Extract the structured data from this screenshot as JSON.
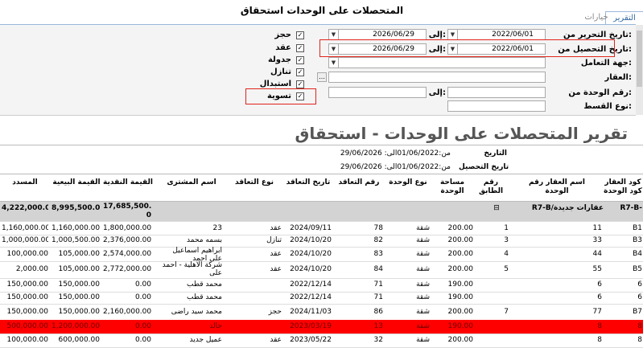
{
  "window": {
    "title": "المتحصلات على الوحدات استحقاق"
  },
  "tabs": [
    {
      "label": "التقرير",
      "active": true
    },
    {
      "label": "خيارات",
      "active": false
    }
  ],
  "filters": {
    "edit_date_label": "تاريخ التحرير من:",
    "edit_from": "2022/06/01",
    "edit_to_label": "إلى:",
    "edit_to": "2026/06/29",
    "collect_date_label": "تاريخ التحصيل من:",
    "collect_from": "2022/06/01",
    "collect_to_label": "إلى:",
    "collect_to": "2026/06/29",
    "party_label": "جهة التعامل:",
    "property_label": "العقار:",
    "unit_no_label": "رقم الوحدة من:",
    "unit_to_label": "إلى:",
    "installment_label": "نوع القسط:"
  },
  "checks": [
    {
      "label": "حجز",
      "checked": true
    },
    {
      "label": "عقد",
      "checked": true
    },
    {
      "label": "جدولة",
      "checked": true
    },
    {
      "label": "تنازل",
      "checked": true
    },
    {
      "label": "استبدال",
      "checked": true
    },
    {
      "label": "تسوية",
      "checked": true
    }
  ],
  "report": {
    "title": "تقرير المتحصلات على الوحدات - استحقاق",
    "date_label": "التاريخ",
    "date_range": "من:01/06/2022الى: 29/06/2026",
    "collect_label": "تاريخ التحصيل",
    "collect_range": "من:01/06/2022الى: 29/06/2026"
  },
  "columns": {
    "code": "كود العقار كود الوحدة",
    "uno": "اسم العقار رقم الوحدة",
    "floor": "رقم الطابق",
    "area": "مساحة الوحدة",
    "utype": "نوع الوحدة",
    "cno": "رقم التعاقد",
    "cdate": "تاريخ التعاقد",
    "ctype": "نوع التعاقد",
    "buyer": "اسم المشترى",
    "cash": "القيمة النقدية",
    "sale": "القيمة البيعية",
    "paid": "المسدد"
  },
  "group": {
    "code": "R7-B-",
    "name": "R7-B/عقارات جديدة",
    "expander": "⊟",
    "cash": "17,685,500.0",
    "cash_cont": "0",
    "sale": "8,995,500.00",
    "paid": "4,222,000.00"
  },
  "rows": [
    {
      "code": "B1",
      "uno": "11",
      "floor": "1",
      "area": "200.00",
      "utype": "شقة",
      "cno": "78",
      "cdate": "2024/09/11",
      "ctype": "عقد",
      "buyer": "23",
      "cash": "1,800,000.00",
      "sale": "1,160,000.00",
      "paid": "1,160,000.00",
      "red": false
    },
    {
      "code": "B3",
      "uno": "33",
      "floor": "3",
      "area": "200.00",
      "utype": "شقة",
      "cno": "82",
      "cdate": "2024/10/20",
      "ctype": "تنازل",
      "buyer": "بسمه محمد",
      "cash": "2,376,000.00",
      "sale": "1,000,500.00",
      "paid": "1,000,000.00",
      "red": false
    },
    {
      "code": "B4",
      "uno": "44",
      "floor": "4",
      "area": "200.00",
      "utype": "شقة",
      "cno": "83",
      "cdate": "2024/10/20",
      "ctype": "عقد",
      "buyer": "ابراهيم اسماعيل على احمد",
      "cash": "2,574,000.00",
      "sale": "105,000.00",
      "paid": "100,000.00",
      "red": false
    },
    {
      "code": "B5",
      "uno": "55",
      "floor": "5",
      "area": "200.00",
      "utype": "شقة",
      "cno": "84",
      "cdate": "2024/10/20",
      "ctype": "عقد",
      "buyer": "شركة الاهلية - احمد على",
      "cash": "2,772,000.00",
      "sale": "105,000.00",
      "paid": "2,000.00",
      "red": false
    },
    {
      "code": "6",
      "uno": "6",
      "floor": "",
      "area": "190.00",
      "utype": "شقة",
      "cno": "71",
      "cdate": "2022/12/14",
      "ctype": "",
      "buyer": "محمد قطب",
      "cash": "0.00",
      "sale": "150,000.00",
      "paid": "150,000.00",
      "red": false
    },
    {
      "code": "6",
      "uno": "6",
      "floor": "",
      "area": "190.00",
      "utype": "شقة",
      "cno": "71",
      "cdate": "2022/12/14",
      "ctype": "",
      "buyer": "محمد قطب",
      "cash": "0.00",
      "sale": "150,000.00",
      "paid": "150,000.00",
      "red": false
    },
    {
      "code": "B7",
      "uno": "77",
      "floor": "7",
      "area": "200.00",
      "utype": "شقة",
      "cno": "86",
      "cdate": "2024/11/03",
      "ctype": "حجز",
      "buyer": "محمد سيد راضى",
      "cash": "2,160,000.00",
      "sale": "150,000.00",
      "paid": "150,000.00",
      "red": false
    },
    {
      "code": "8",
      "uno": "8",
      "floor": "",
      "area": "190.00",
      "utype": "شقة",
      "cno": "13",
      "cdate": "2023/03/19",
      "ctype": "",
      "buyer": "خالد",
      "cash": "0.00",
      "sale": "1,200,000.00",
      "paid": "500,000.00",
      "red": true
    },
    {
      "code": "8",
      "uno": "8",
      "floor": "",
      "area": "200.00",
      "utype": "شقة",
      "cno": "32",
      "cdate": "2023/05/22",
      "ctype": "عقد",
      "buyer": "عميل جديد",
      "cash": "0.00",
      "sale": "600,000.00",
      "paid": "100,000.00",
      "red": false
    }
  ]
}
